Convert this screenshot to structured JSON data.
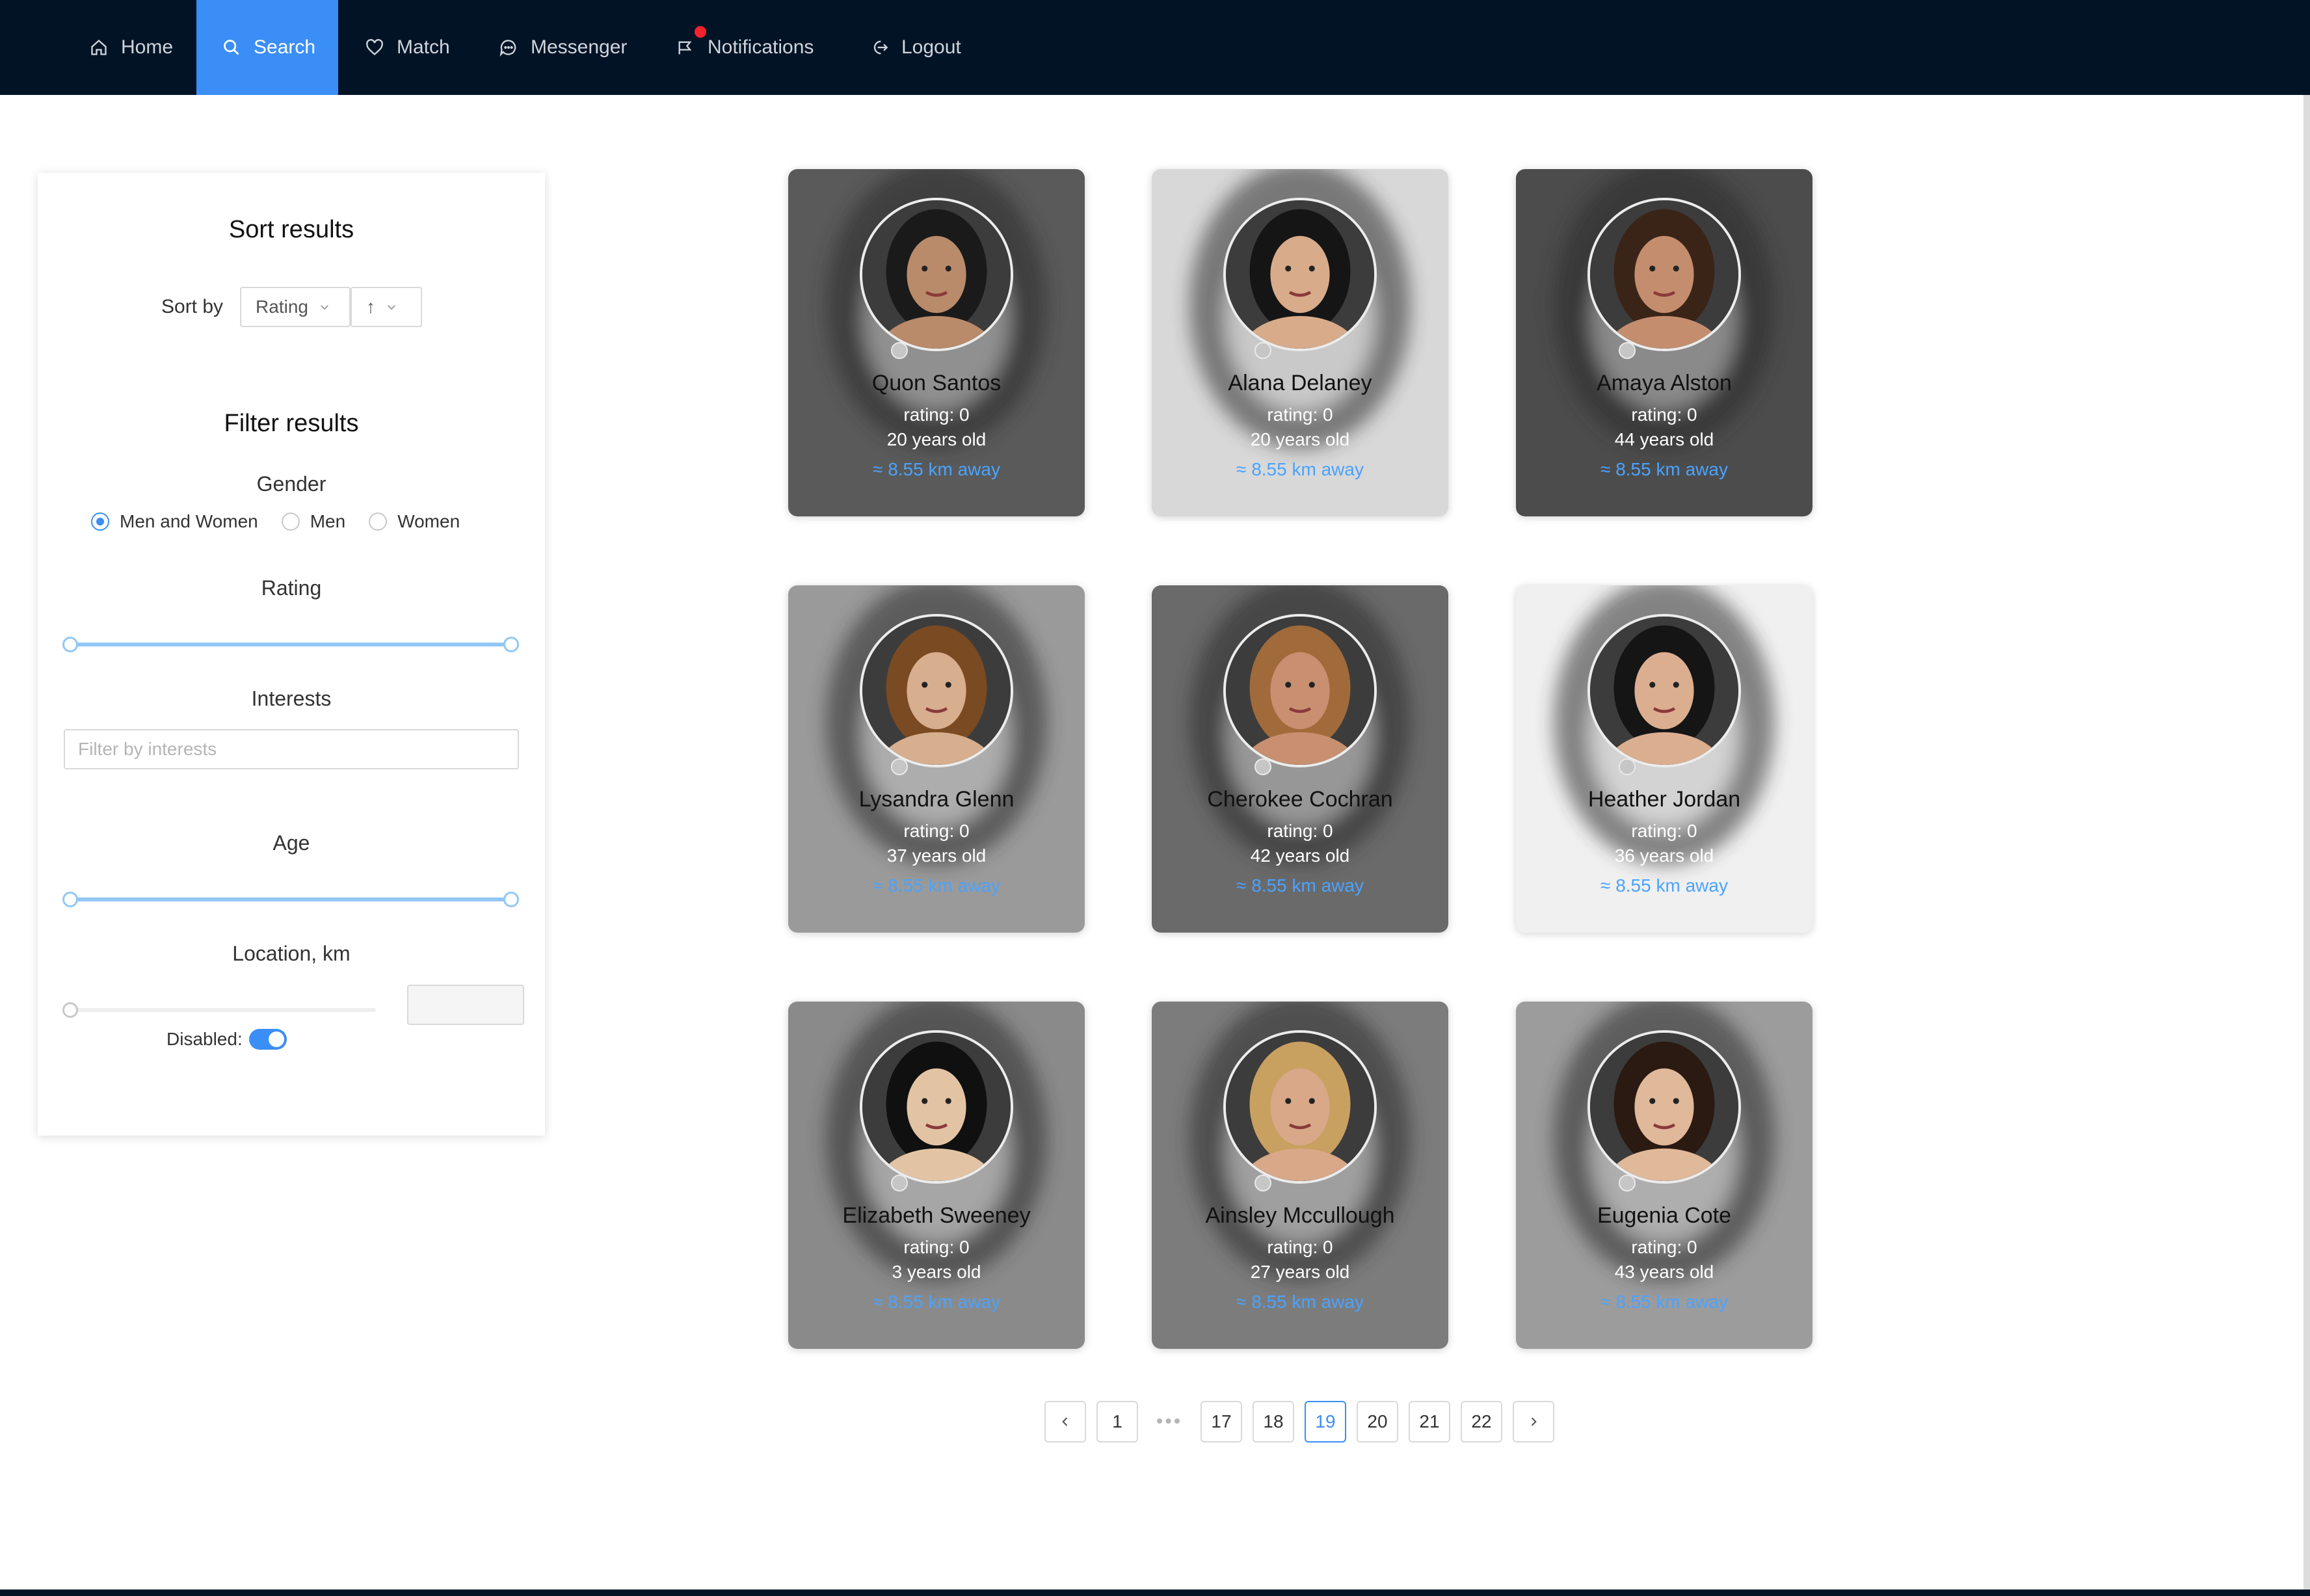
{
  "nav": {
    "items": [
      {
        "label": "Home",
        "icon": "home-icon",
        "active": false
      },
      {
        "label": "Search",
        "icon": "search-icon",
        "active": true
      },
      {
        "label": "Match",
        "icon": "heart-icon",
        "active": false
      },
      {
        "label": "Messenger",
        "icon": "message-icon",
        "active": false
      },
      {
        "label": "Notifications",
        "icon": "notification-icon",
        "active": false,
        "badge": true
      },
      {
        "label": "Logout",
        "icon": "logout-icon",
        "active": false
      }
    ]
  },
  "colors": {
    "nav_bg": "#031326",
    "accent": "#3a8ef5",
    "distance": "#4aa3ff",
    "badge": "#f5222d"
  },
  "sort": {
    "title": "Sort results",
    "label": "Sort by",
    "field": "Rating",
    "direction": "↑"
  },
  "filter": {
    "title": "Filter results",
    "gender": {
      "label": "Gender",
      "options": [
        "Men and Women",
        "Men",
        "Women"
      ],
      "selected": "Men and Women"
    },
    "rating": {
      "label": "Rating",
      "range_fraction": [
        0,
        1
      ]
    },
    "interests": {
      "label": "Interests",
      "placeholder": "Filter by interests"
    },
    "age": {
      "label": "Age",
      "range_fraction": [
        0,
        1
      ]
    },
    "location": {
      "label": "Location, km",
      "value_fraction": 0,
      "disabled_label": "Disabled:",
      "disabled": true
    }
  },
  "profiles": [
    {
      "name": "Quon Santos",
      "rating": "rating: 0",
      "age": "20 years old",
      "distance": "≈ 8.55 km away"
    },
    {
      "name": "Alana Delaney",
      "rating": "rating: 0",
      "age": "20 years old",
      "distance": "≈ 8.55 km away"
    },
    {
      "name": "Amaya Alston",
      "rating": "rating: 0",
      "age": "44 years old",
      "distance": "≈ 8.55 km away"
    },
    {
      "name": "Lysandra Glenn",
      "rating": "rating: 0",
      "age": "37 years old",
      "distance": "≈ 8.55 km away"
    },
    {
      "name": "Cherokee Cochran",
      "rating": "rating: 0",
      "age": "42 years old",
      "distance": "≈ 8.55 km away"
    },
    {
      "name": "Heather Jordan",
      "rating": "rating: 0",
      "age": "36 years old",
      "distance": "≈ 8.55 km away"
    },
    {
      "name": "Elizabeth Sweeney",
      "rating": "rating: 0",
      "age": "3 years old",
      "distance": "≈ 8.55 km away"
    },
    {
      "name": "Ainsley Mccullough",
      "rating": "rating: 0",
      "age": "27 years old",
      "distance": "≈ 8.55 km away"
    },
    {
      "name": "Eugenia Cote",
      "rating": "rating: 0",
      "age": "43 years old",
      "distance": "≈ 8.55 km away"
    }
  ],
  "pagination": {
    "pages": [
      "1",
      "17",
      "18",
      "19",
      "20",
      "21",
      "22"
    ],
    "current": "19",
    "ellipsis": "•••"
  }
}
